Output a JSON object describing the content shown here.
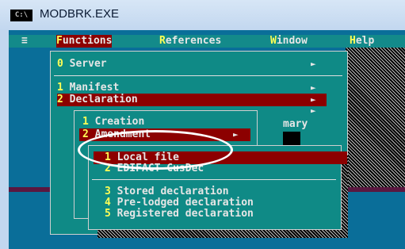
{
  "window": {
    "title": "MODBRK.EXE",
    "icon_label": "C:\\"
  },
  "menubar": {
    "system_glyph": "≡",
    "items": [
      {
        "hotkey": "F",
        "rest": "unctions"
      },
      {
        "hotkey": "R",
        "rest": "eferences"
      },
      {
        "hotkey": "W",
        "rest": "indow"
      },
      {
        "hotkey": "H",
        "rest": "elp"
      }
    ]
  },
  "functions_menu": {
    "items": [
      {
        "num": "0",
        "label": " Server"
      },
      {
        "num": "1",
        "label": " Manifest"
      },
      {
        "num": "2",
        "label": " Declaration"
      }
    ]
  },
  "declaration_menu": {
    "items": [
      {
        "num": "1",
        "label": " Creation"
      },
      {
        "num": "2",
        "label": " Amendment"
      }
    ],
    "background_text": "mary"
  },
  "amendment_menu": {
    "items": [
      {
        "num": "1",
        "label": " Local file"
      },
      {
        "num": "2",
        "label": " EDIFACT CusDec"
      },
      {
        "num": "3",
        "label": " Stored declaration"
      },
      {
        "num": "4",
        "label": " Pre-lodged declaration"
      },
      {
        "num": "5",
        "label": " Registered declaration"
      }
    ]
  },
  "icons": {
    "submenu_arrow": "►",
    "app_icon": "console-icon"
  },
  "colors": {
    "menu_bg": "#0f8a86",
    "selection": "#8c0000",
    "hotkey": "#ffff55",
    "desktop": "#0a6e99"
  }
}
